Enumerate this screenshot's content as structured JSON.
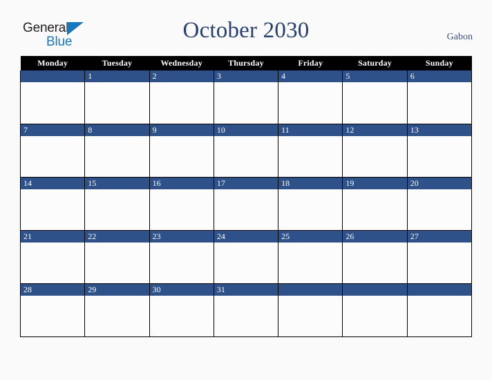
{
  "brand": {
    "name_part1": "General",
    "name_part2": "Blue",
    "triangle_icon": "triangle-icon",
    "color_dark": "#231f20",
    "color_blue": "#1878be"
  },
  "header": {
    "title": "October 2030",
    "country": "Gabon",
    "title_color": "#28406b"
  },
  "calendar": {
    "month": "October",
    "year": "2030",
    "weekday_headers": [
      "Monday",
      "Tuesday",
      "Wednesday",
      "Thursday",
      "Friday",
      "Saturday",
      "Sunday"
    ],
    "header_bg": "#000000",
    "header_fg": "#ffffff",
    "daybar_bg": "#2e5189",
    "daybar_fg": "#ffffff",
    "cell_bg": "#fcfcfd",
    "border_color": "#000000",
    "weeks": [
      {
        "days": [
          {
            "num": ""
          },
          {
            "num": "1"
          },
          {
            "num": "2"
          },
          {
            "num": "3"
          },
          {
            "num": "4"
          },
          {
            "num": "5"
          },
          {
            "num": "6"
          }
        ]
      },
      {
        "days": [
          {
            "num": "7"
          },
          {
            "num": "8"
          },
          {
            "num": "9"
          },
          {
            "num": "10"
          },
          {
            "num": "11"
          },
          {
            "num": "12"
          },
          {
            "num": "13"
          }
        ]
      },
      {
        "days": [
          {
            "num": "14"
          },
          {
            "num": "15"
          },
          {
            "num": "16"
          },
          {
            "num": "17"
          },
          {
            "num": "18"
          },
          {
            "num": "19"
          },
          {
            "num": "20"
          }
        ]
      },
      {
        "days": [
          {
            "num": "21"
          },
          {
            "num": "22"
          },
          {
            "num": "23"
          },
          {
            "num": "24"
          },
          {
            "num": "25"
          },
          {
            "num": "26"
          },
          {
            "num": "27"
          }
        ]
      },
      {
        "days": [
          {
            "num": "28"
          },
          {
            "num": "29"
          },
          {
            "num": "30"
          },
          {
            "num": "31"
          },
          {
            "num": ""
          },
          {
            "num": ""
          },
          {
            "num": ""
          }
        ]
      }
    ]
  }
}
